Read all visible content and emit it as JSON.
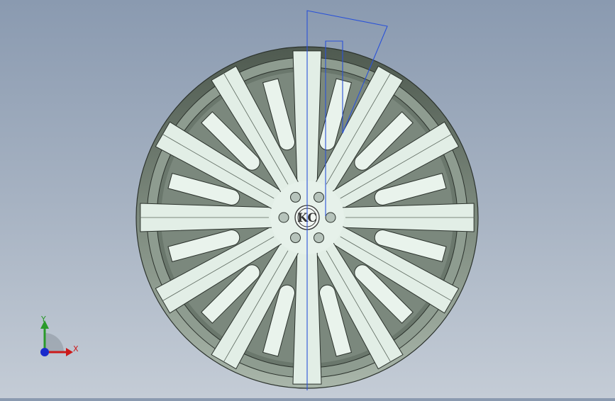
{
  "viewport": {
    "background_top": "#8a9ab0",
    "background_bottom": "#c4ccd6"
  },
  "model": {
    "spoke_count": 12,
    "lug_hole_count": 6,
    "hub_logo": "KC",
    "rim_color": "#5f6b5f",
    "face_color": "#d6e6dc",
    "sketch_color": "#2a52d8"
  },
  "triad": {
    "x_label": "X",
    "y_label": "Y",
    "x_color": "#cc1a1a",
    "y_color": "#2a9a2a",
    "z_color": "#1a2acc"
  }
}
